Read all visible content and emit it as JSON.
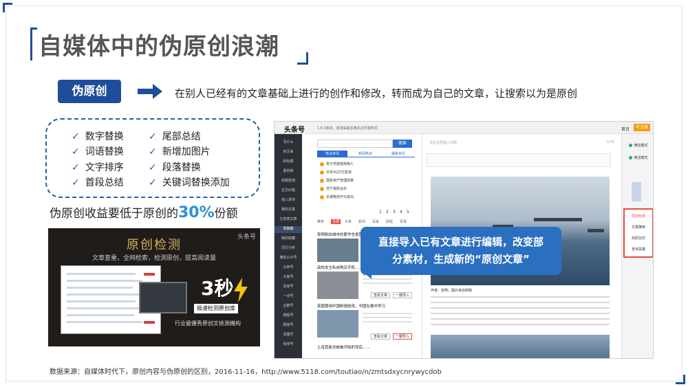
{
  "slide": {
    "title": "自媒体中的伪原创浪潮",
    "tag": "伪原创",
    "definition": "在别人已经有的文章基础上进行的创作和修改，转而成为自己的文章，让搜索以为是原创",
    "methods_left": [
      "数字替换",
      "词语替换",
      "文字排序",
      "首段总结"
    ],
    "methods_right": [
      "尾部总结",
      "新增加图片",
      "段落替换",
      "关键词替换添加"
    ],
    "income_prefix": "伪原创收益要低于原创的",
    "income_pct": "30%",
    "income_suffix": "份额",
    "source": "数据来源：自媒体时代下，原创内容与伪原创的区别，2016-11-16，http://www.5118.com/toutiao/n/zmtsdxycnrywycdob"
  },
  "detect_image": {
    "logo": "头条号",
    "title": "原创检测",
    "subtitle": "文章查重，全网检索，检测原创，提高阅读量",
    "seconds": "3秒",
    "button": "极速检测原创度",
    "footer": "行业最優秀原创文檢測機构"
  },
  "screenshot": {
    "logo": "头条号",
    "notice": "1.8.3版本，新增采集多格式文件和时间",
    "home": "首页",
    "write": "写文章",
    "side_items": [
      "写什么",
      "好文采",
      "好标题",
      "素材库",
      "标题检测",
      "正文纠错",
      "插入素材",
      "我的文章",
      "已发表文章",
      "草稿箱",
      "我的收藏",
      "同行分析",
      "微信公众号",
      "头条号",
      "大鱼号",
      "百家号",
      "一点号",
      "企鹅号",
      "搜狐号",
      "网易号",
      "凤凰号",
      "快传号"
    ],
    "search_btn": "搜索",
    "tabs": [
      "热点资讯",
      "新闻热点",
      "最新资讯"
    ],
    "hot_items": [
      "男子驾驶撞死两人",
      "日本5G万亿投资",
      "国有资产管理改革",
      "苏宁易购合并",
      "长城物流开元成功"
    ],
    "pages": [
      "1",
      "2",
      "3",
      "4",
      "5"
    ],
    "categories": [
      "推荐",
      "全部",
      "头条",
      "新闻",
      "百家",
      "财经",
      "军事"
    ],
    "news": [
      {
        "title": "昆明航拍城市的繁华全景图，第一个都未曾看到"
      },
      {
        "title": "高校女生私自购买手机……",
        "btn_a": "查看文章",
        "btn_b": "一键导入"
      },
      {
        "title": "英国使用中国制造航母，中国在看中学习",
        "btn_a": "查看文章",
        "btn_b": "一键导入"
      }
    ],
    "last_news": "土耳其新总统被开除的背后……",
    "editor_placeholder": "请在这里输入标题",
    "editor_count": "0/30",
    "caption": "作者：张明；图片来自网络",
    "right_buttons": [
      "微信模式",
      "简洁模式"
    ],
    "panel_items": [
      "原创检测",
      "文章推荐",
      "伪原创文",
      "查询关键"
    ]
  },
  "callout": {
    "line1": "直接导入已有文章进行编辑，改变部",
    "line2": "分素材，生成新的“原创文章”"
  },
  "colors": {
    "brand": "#1e4e9a",
    "accent": "#2a8fd8",
    "callout": "#2b6fc0",
    "highlight": "#e74c3c"
  }
}
